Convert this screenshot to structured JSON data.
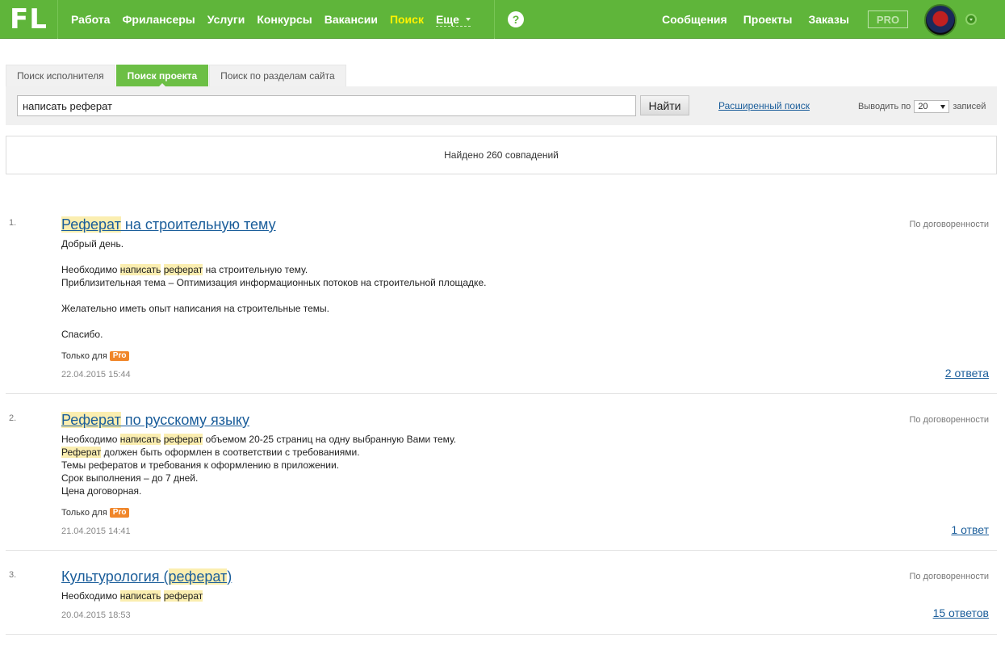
{
  "header": {
    "logo": "FL",
    "nav": [
      "Работа",
      "Фрилансеры",
      "Услуги",
      "Конкурсы",
      "Вакансии",
      "Поиск"
    ],
    "nav_active": "Поиск",
    "more": "Еще",
    "help": "?",
    "right_nav": [
      "Сообщения",
      "Проекты",
      "Заказы"
    ],
    "pro": "PRO"
  },
  "tabs": [
    "Поиск исполнителя",
    "Поиск проекта",
    "Поиск по разделам сайта"
  ],
  "search": {
    "value": "написать реферат",
    "button": "Найти",
    "advanced": "Расширенный поиск",
    "per_page_prefix": "Выводить по",
    "per_page_value": "20",
    "per_page_suffix": "записей"
  },
  "results_count": "Найдено 260 совпадений",
  "results": [
    {
      "num": "1.",
      "title_parts": [
        [
          "Реферат",
          true
        ],
        [
          " на строительную тему",
          false
        ]
      ],
      "budget": "По договоренности",
      "lines": [
        [
          [
            "Добрый день.",
            false
          ]
        ],
        [],
        [
          [
            "Необходимо ",
            false
          ],
          [
            "написать",
            true
          ],
          [
            " ",
            false
          ],
          [
            "реферат",
            true
          ],
          [
            " на строительную тему.",
            false
          ]
        ],
        [
          [
            "Приблизительная тема – Оптимизация информационных потоков на строительной площадке.",
            false
          ]
        ],
        [],
        [
          [
            "Желательно иметь опыт написания на строительные темы.",
            false
          ]
        ],
        [],
        [
          [
            "Спасибо.",
            false
          ]
        ]
      ],
      "only_for": "Только для",
      "badge": "Pro",
      "date": "22.04.2015 15:44",
      "answers": "2 ответа"
    },
    {
      "num": "2.",
      "title_parts": [
        [
          "Реферат",
          true
        ],
        [
          " по русскому языку",
          false
        ]
      ],
      "budget": "По договоренности",
      "lines": [
        [
          [
            "Необходимо ",
            false
          ],
          [
            "написать",
            true
          ],
          [
            " ",
            false
          ],
          [
            "реферат",
            true
          ],
          [
            " объемом 20-25 страниц на одну выбранную Вами тему.",
            false
          ]
        ],
        [
          [
            "Реферат",
            true
          ],
          [
            " должен быть оформлен в соответствии с требованиями.",
            false
          ]
        ],
        [
          [
            "Темы рефератов и требования к оформлению в приложении.",
            false
          ]
        ],
        [
          [
            "Срок выполнения – до 7 дней.",
            false
          ]
        ],
        [
          [
            "Цена договорная.",
            false
          ]
        ]
      ],
      "only_for": "Только для",
      "badge": "Pro",
      "date": "21.04.2015 14:41",
      "answers": "1 ответ"
    },
    {
      "num": "3.",
      "title_parts": [
        [
          "Культурология (",
          false
        ],
        [
          "реферат",
          true
        ],
        [
          ")",
          false
        ]
      ],
      "budget": "По договоренности",
      "lines": [
        [
          [
            "Необходимо ",
            false
          ],
          [
            "написать",
            true
          ],
          [
            " ",
            false
          ],
          [
            "реферат",
            true
          ]
        ]
      ],
      "only_for": null,
      "badge": null,
      "date": "20.04.2015 18:53",
      "answers": "15 ответов"
    }
  ],
  "colors": {
    "header_green": "#5fb53a",
    "active_tab_green": "#6cbf45",
    "nav_active_yellow": "#fff200",
    "link_blue": "#1a5d9a",
    "highlight": "#fbeeb0",
    "pro_orange": "#f0862a"
  }
}
